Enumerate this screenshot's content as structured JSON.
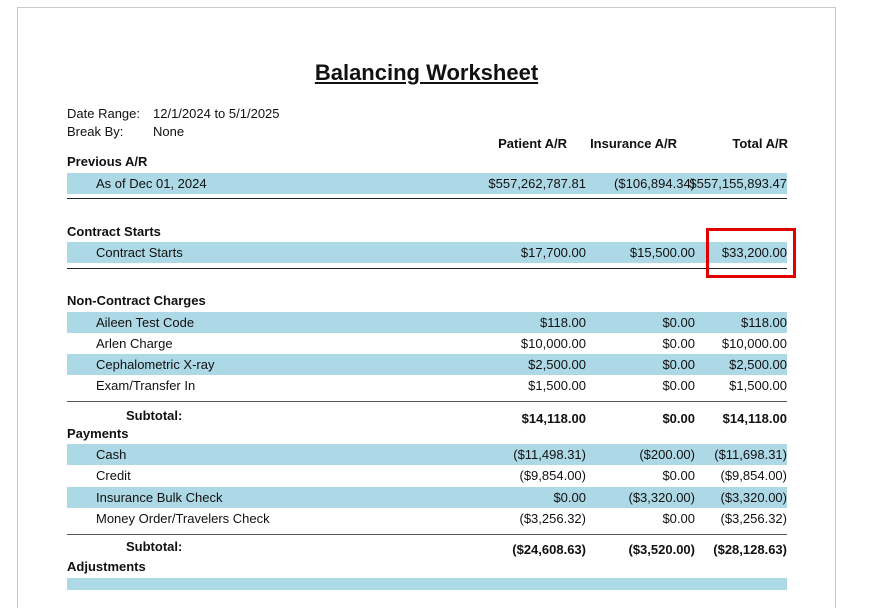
{
  "title": "Balancing Worksheet",
  "meta": {
    "date_range_label": "Date Range:",
    "date_range_value": "12/1/2024 to 5/1/2025",
    "break_by_label": "Break By:",
    "break_by_value": "None"
  },
  "columns": {
    "patient": "Patient A/R",
    "insurance": "Insurance A/R",
    "total": "Total A/R"
  },
  "previous": {
    "heading": "Previous A/R",
    "rows": [
      {
        "label": "As of Dec 01, 2024",
        "patient": "$557,262,787.81",
        "insurance": "($106,894.34)",
        "total": "$557,155,893.47"
      }
    ]
  },
  "contract": {
    "heading": "Contract Starts",
    "rows": [
      {
        "label": "Contract Starts",
        "patient": "$17,700.00",
        "insurance": "$15,500.00",
        "total": "$33,200.00"
      }
    ]
  },
  "noncontract": {
    "heading": "Non-Contract Charges",
    "rows": [
      {
        "label": "Aileen Test Code",
        "patient": "$118.00",
        "insurance": "$0.00",
        "total": "$118.00"
      },
      {
        "label": "Arlen Charge",
        "patient": "$10,000.00",
        "insurance": "$0.00",
        "total": "$10,000.00"
      },
      {
        "label": "Cephalometric X-ray",
        "patient": "$2,500.00",
        "insurance": "$0.00",
        "total": "$2,500.00"
      },
      {
        "label": "Exam/Transfer In",
        "patient": "$1,500.00",
        "insurance": "$0.00",
        "total": "$1,500.00"
      }
    ],
    "subtotal": {
      "label": "Subtotal:",
      "patient": "$14,118.00",
      "insurance": "$0.00",
      "total": "$14,118.00"
    }
  },
  "payments": {
    "heading": "Payments",
    "rows": [
      {
        "label": "Cash",
        "patient": "($11,498.31)",
        "insurance": "($200.00)",
        "total": "($11,698.31)"
      },
      {
        "label": "Credit",
        "patient": "($9,854.00)",
        "insurance": "$0.00",
        "total": "($9,854.00)"
      },
      {
        "label": "Insurance Bulk Check",
        "patient": "$0.00",
        "insurance": "($3,320.00)",
        "total": "($3,320.00)"
      },
      {
        "label": "Money Order/Travelers Check",
        "patient": "($3,256.32)",
        "insurance": "$0.00",
        "total": "($3,256.32)"
      }
    ],
    "subtotal": {
      "label": "Subtotal:",
      "patient": "($24,608.63)",
      "insurance": "($3,520.00)",
      "total": "($28,128.63)"
    }
  },
  "adjustments": {
    "heading": "Adjustments"
  },
  "colors": {
    "row_shade": "#add8e6",
    "highlight": "#e00000"
  }
}
